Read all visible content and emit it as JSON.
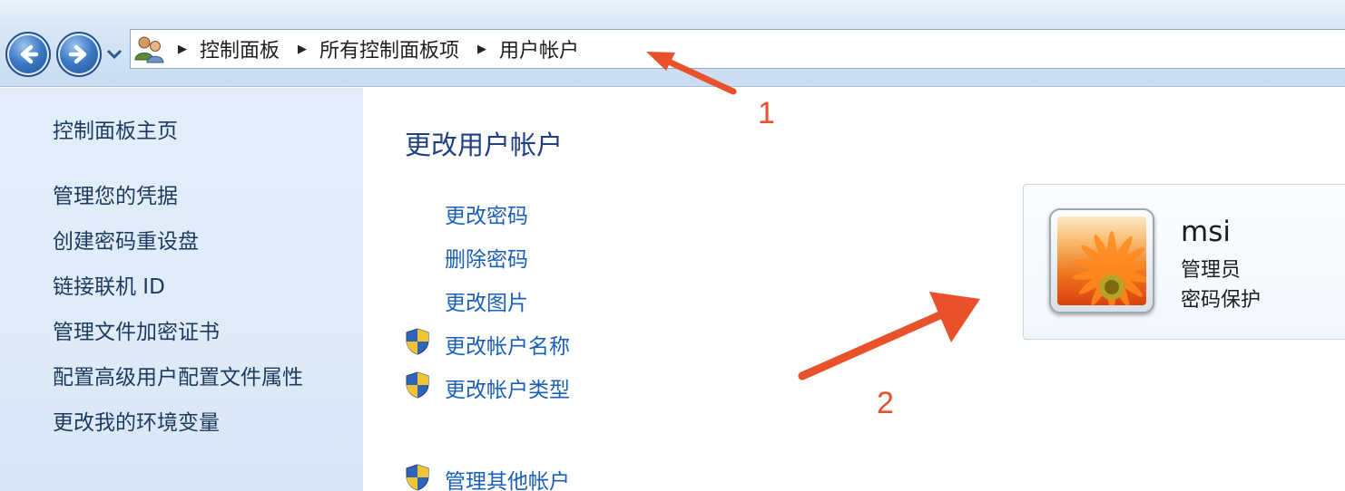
{
  "address_bar": {
    "breadcrumbs": [
      "控制面板",
      "所有控制面板项",
      "用户帐户"
    ]
  },
  "sidebar": {
    "items": [
      {
        "label": "控制面板主页"
      },
      {
        "label": "管理您的凭据"
      },
      {
        "label": "创建密码重设盘"
      },
      {
        "label": "链接联机 ID"
      },
      {
        "label": "管理文件加密证书"
      },
      {
        "label": "配置高级用户配置文件属性"
      },
      {
        "label": "更改我的环境变量"
      }
    ]
  },
  "main": {
    "title": "更改用户帐户",
    "tasks": [
      {
        "label": "更改密码",
        "shield": false
      },
      {
        "label": "删除密码",
        "shield": false
      },
      {
        "label": "更改图片",
        "shield": false
      },
      {
        "label": "更改帐户名称",
        "shield": true
      },
      {
        "label": "更改帐户类型",
        "shield": true
      },
      {
        "label": "管理其他帐户",
        "shield": true
      }
    ]
  },
  "account": {
    "name": "msi",
    "type": "管理员",
    "password_status": "密码保护"
  },
  "annotations": {
    "labels": [
      "1",
      "2"
    ],
    "color": "#e8512a"
  },
  "colors": {
    "sidebar_text": "#1c3a5e",
    "link": "#1a5fb8",
    "title": "#1e3f86"
  },
  "icons": [
    "back-arrow-icon",
    "forward-arrow-icon",
    "history-dropdown-icon",
    "users-icon",
    "breadcrumb-arrow-icon",
    "uac-shield-icon"
  ]
}
